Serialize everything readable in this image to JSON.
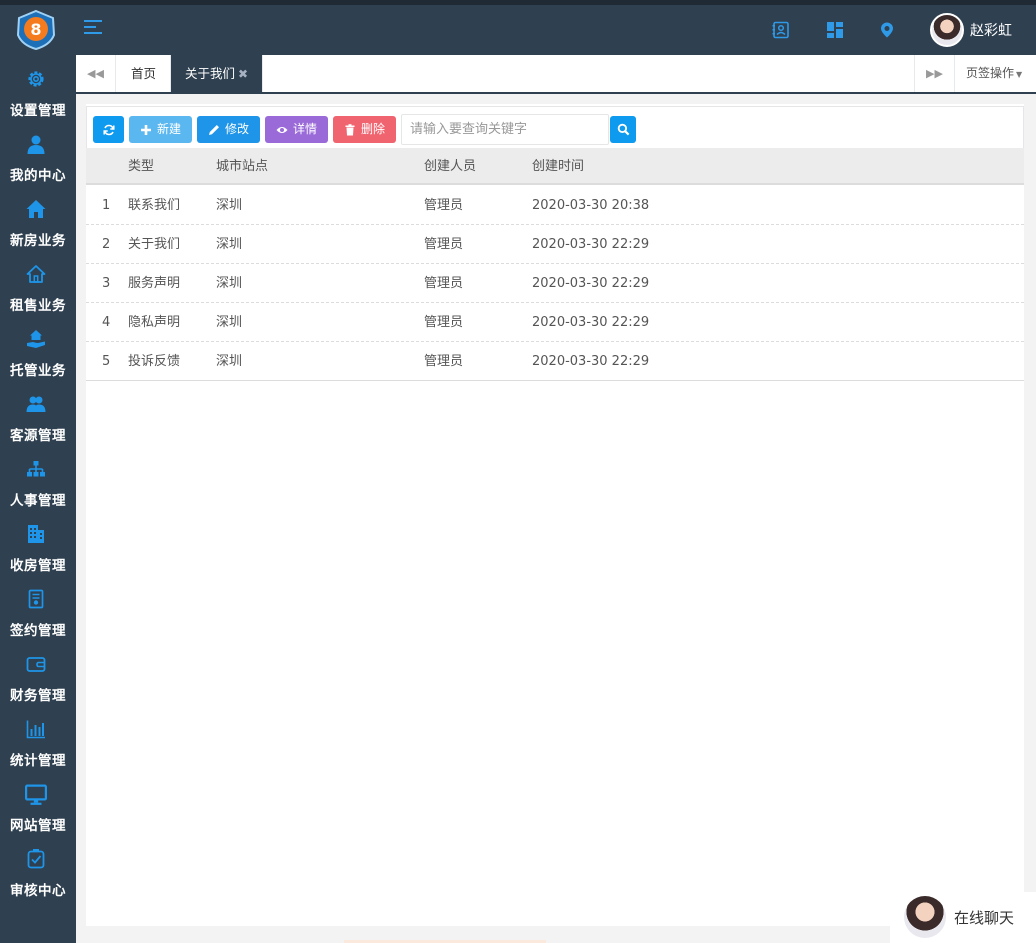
{
  "colors": {
    "sidebar_bg": "#2f4050",
    "accent": "#0e9aef"
  },
  "header": {
    "logo_text": "8",
    "menu_icon": "hamburger-icon",
    "icons": [
      "contacts-icon",
      "dashboard-icon",
      "location-icon"
    ],
    "user_name": "赵彩虹"
  },
  "sidebar": {
    "items": [
      {
        "label": "设置管理",
        "icon": "gear-icon"
      },
      {
        "label": "我的中心",
        "icon": "user-icon"
      },
      {
        "label": "新房业务",
        "icon": "house-icon"
      },
      {
        "label": "租售业务",
        "icon": "home-outline-icon"
      },
      {
        "label": "托管业务",
        "icon": "hand-house-icon"
      },
      {
        "label": "客源管理",
        "icon": "users-icon"
      },
      {
        "label": "人事管理",
        "icon": "org-chart-icon"
      },
      {
        "label": "收房管理",
        "icon": "building-icon"
      },
      {
        "label": "签约管理",
        "icon": "contract-icon"
      },
      {
        "label": "财务管理",
        "icon": "wallet-icon"
      },
      {
        "label": "统计管理",
        "icon": "bar-chart-icon"
      },
      {
        "label": "网站管理",
        "icon": "monitor-icon"
      },
      {
        "label": "审核中心",
        "icon": "check-doc-icon"
      }
    ]
  },
  "tabs": {
    "items": [
      {
        "label": "首页"
      },
      {
        "label": "关于我们",
        "active": true
      }
    ],
    "close_symbol": "✖",
    "operations_label": "页签操作"
  },
  "toolbar": {
    "new_label": "新建",
    "edit_label": "修改",
    "detail_label": "详情",
    "delete_label": "删除",
    "search_placeholder": "请输入要查询关键字"
  },
  "table": {
    "columns": [
      "类型",
      "城市站点",
      "创建人员",
      "创建时间"
    ],
    "rows": [
      {
        "index": "1",
        "type": "联系我们",
        "city": "深圳",
        "creator": "管理员",
        "time": "2020-03-30 20:38"
      },
      {
        "index": "2",
        "type": "关于我们",
        "city": "深圳",
        "creator": "管理员",
        "time": "2020-03-30 22:29"
      },
      {
        "index": "3",
        "type": "服务声明",
        "city": "深圳",
        "creator": "管理员",
        "time": "2020-03-30 22:29"
      },
      {
        "index": "4",
        "type": "隐私声明",
        "city": "深圳",
        "creator": "管理员",
        "time": "2020-03-30 22:29"
      },
      {
        "index": "5",
        "type": "投诉反馈",
        "city": "深圳",
        "creator": "管理员",
        "time": "2020-03-30 22:29"
      }
    ]
  },
  "chat": {
    "label": "在线聊天"
  }
}
